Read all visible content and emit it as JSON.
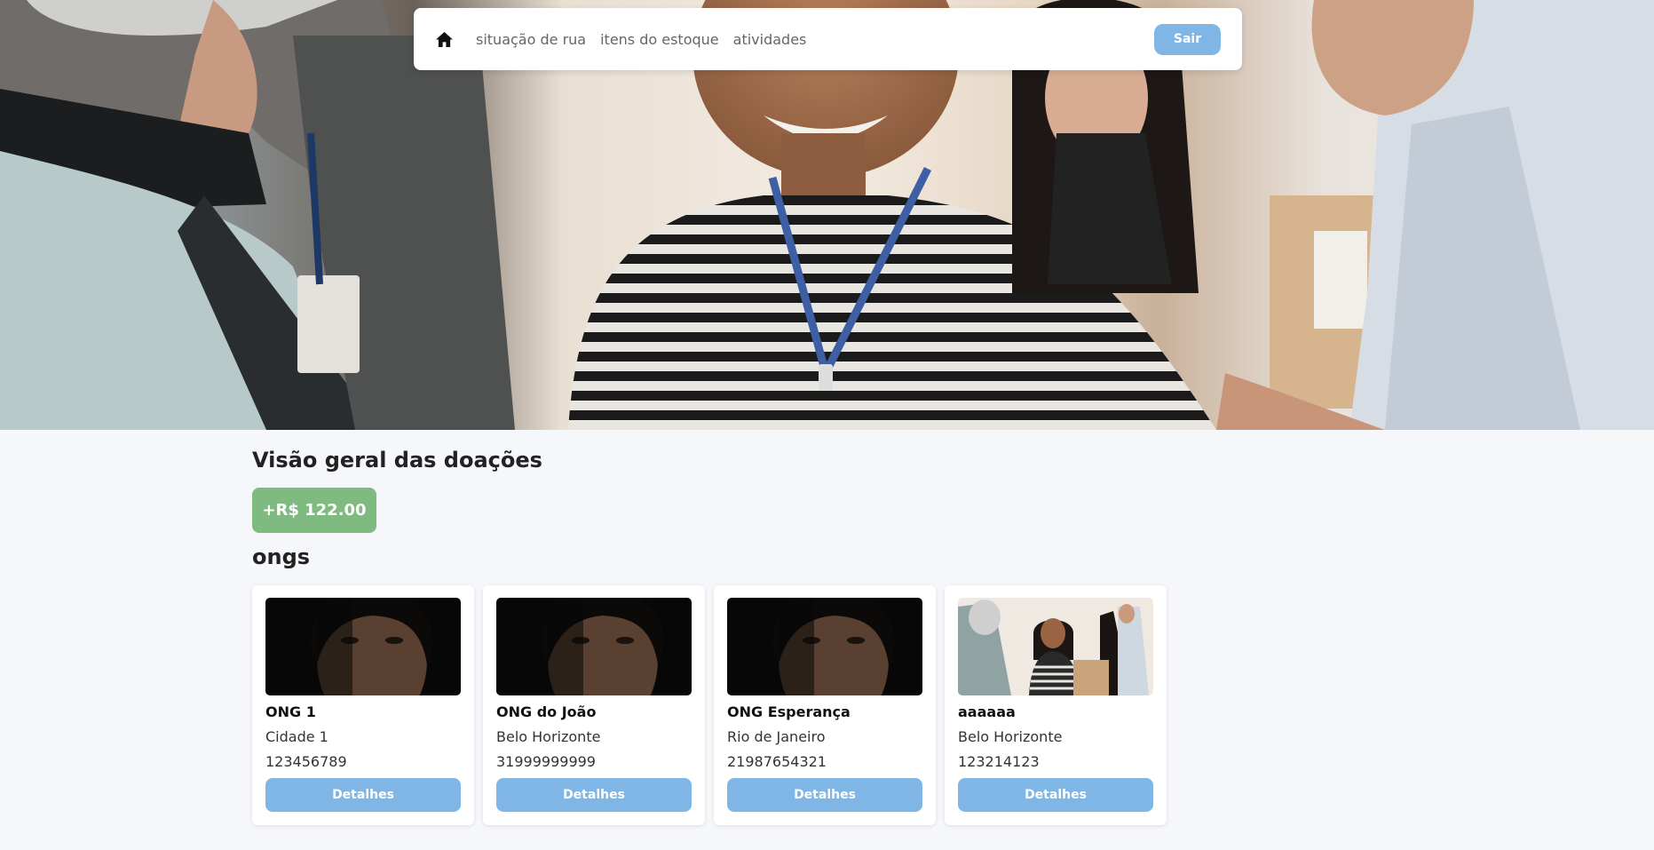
{
  "navbar": {
    "home_icon": "home-icon",
    "links": [
      "situação de rua",
      "itens do estoque",
      "atividades"
    ],
    "logout_label": "Sair"
  },
  "hero": {
    "image": "volunteers-smiling-photo"
  },
  "donations": {
    "title": "Visão geral das doações",
    "total": "+R$ 122.00"
  },
  "ongs": {
    "title": "ongs",
    "items": [
      {
        "name": "ONG 1",
        "city": "Cidade 1",
        "phone": "123456789",
        "image": "portrait-photo",
        "button": "Detalhes"
      },
      {
        "name": "ONG do João",
        "city": "Belo Horizonte",
        "phone": "31999999999",
        "image": "portrait-photo",
        "button": "Detalhes"
      },
      {
        "name": "ONG Esperança",
        "city": "Rio de Janeiro",
        "phone": "21987654321",
        "image": "portrait-photo",
        "button": "Detalhes"
      },
      {
        "name": "aaaaaa",
        "city": "Belo Horizonte",
        "phone": "123214123",
        "image": "volunteers-photo",
        "button": "Detalhes"
      }
    ]
  },
  "colors": {
    "accent": "#7fb6e6",
    "donation_badge": "#7fba80",
    "background": "#f5f7fa"
  }
}
